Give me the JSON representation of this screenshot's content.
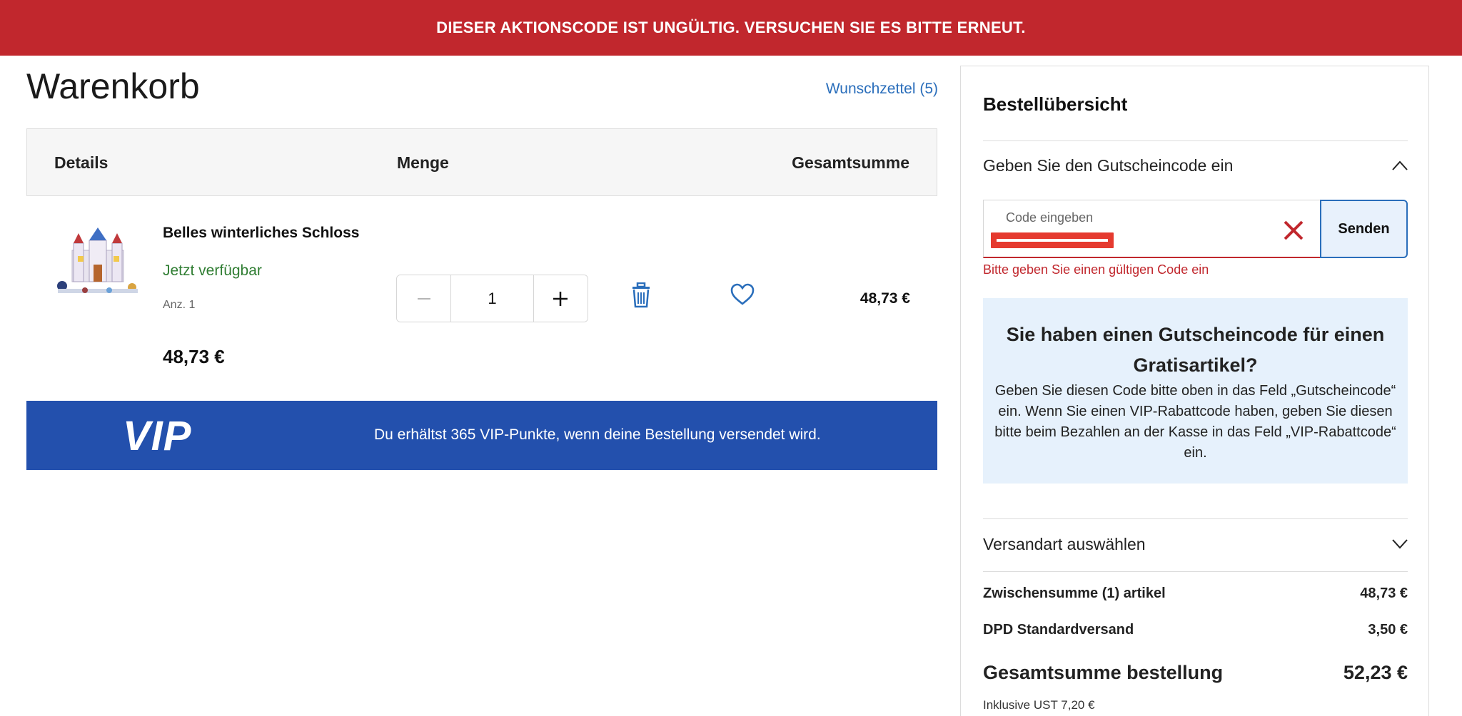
{
  "alert": {
    "message": "DIESER AKTIONSCODE IST UNGÜLTIG. VERSUCHEN SIE ES BITTE ERNEUT."
  },
  "page": {
    "title": "Warenkorb",
    "wishlist_link": "Wunschzettel (5)"
  },
  "cart": {
    "headers": {
      "details": "Details",
      "quantity": "Menge",
      "total": "Gesamtsumme"
    },
    "item": {
      "name": "Belles winterliches Schloss",
      "availability": "Jetzt verfügbar",
      "quantity_label": "Anz. 1",
      "price": "48,73 €",
      "quantity": "1",
      "line_total": "48,73 €"
    }
  },
  "vip": {
    "logo": "VIP",
    "message": "Du erhältst 365 VIP-Punkte, wenn deine Bestellung versendet wird."
  },
  "summary": {
    "title": "Bestellübersicht",
    "coupon": {
      "toggle_label": "Geben Sie den Gutscheincode ein",
      "placeholder": "Code eingeben",
      "submit_label": "Senden",
      "error": "Bitte geben Sie einen gültigen Code ein"
    },
    "gift_info": {
      "title": "Sie haben einen Gutscheincode für einen Gratisartikel?",
      "text": "Geben Sie diesen Code bitte oben in das Feld „Gutscheincode“ ein. Wenn Sie einen VIP-Rabattcode haben, geben Sie diesen bitte beim Bezahlen an der Kasse in das Feld „VIP-Rabattcode“ ein."
    },
    "shipping_toggle_label": "Versandart auswählen",
    "subtotal_label": "Zwischensumme (1) artikel",
    "subtotal_value": "48,73 €",
    "shipping_label": "DPD Standardversand",
    "shipping_value": "3,50 €",
    "grand_total_label": "Gesamtsumme bestellung",
    "grand_total_value": "52,23 €",
    "vat_note": "Inklusive UST 7,20 €"
  },
  "colors": {
    "alert_red": "#c1272d",
    "link_blue": "#2a6ebb",
    "vip_blue": "#2350ad",
    "available_green": "#2f7d32",
    "info_bg": "#e6f1fc"
  }
}
